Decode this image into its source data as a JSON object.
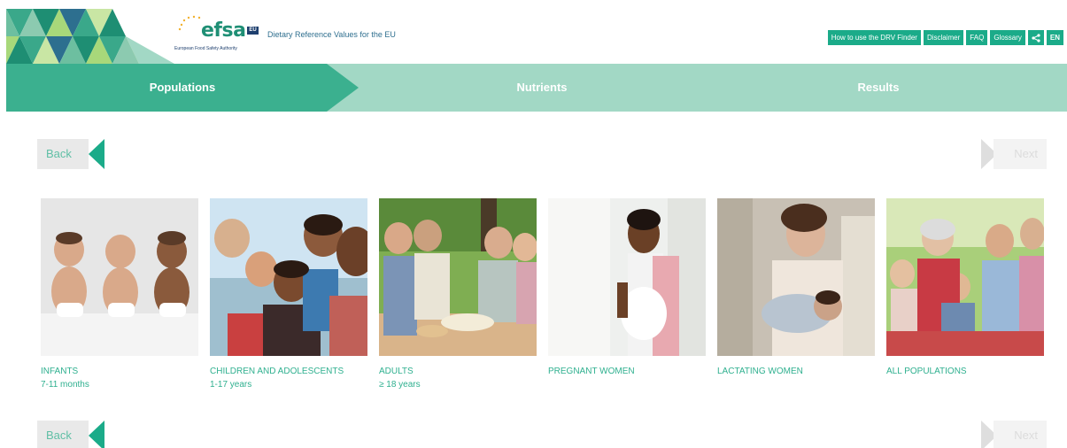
{
  "header": {
    "logo_word": "efsa",
    "logo_badge": "EU",
    "logo_subtitle": "European Food Safety Authority",
    "site_title": "Dietary Reference Values for the EU",
    "links": [
      {
        "label": "How to use the DRV Finder"
      },
      {
        "label": "Disclaimer"
      },
      {
        "label": "FAQ"
      },
      {
        "label": "Glossary"
      }
    ],
    "share_icon": "share-icon",
    "language": "EN"
  },
  "steps": [
    {
      "label": "Populations",
      "active": true
    },
    {
      "label": "Nutrients",
      "active": false
    },
    {
      "label": "Results",
      "active": false
    }
  ],
  "nav": {
    "back_label": "Back",
    "next_label": "Next",
    "back_enabled": true,
    "next_enabled": false
  },
  "populations": [
    {
      "title": "INFANTS",
      "subtitle": "7-11 months"
    },
    {
      "title": "CHILDREN AND ADOLESCENTS",
      "subtitle": "1-17 years"
    },
    {
      "title": "ADULTS",
      "subtitle": "≥ 18 years"
    },
    {
      "title": "PREGNANT WOMEN",
      "subtitle": ""
    },
    {
      "title": "LACTATING WOMEN",
      "subtitle": ""
    },
    {
      "title": "ALL POPULATIONS",
      "subtitle": ""
    }
  ],
  "colors": {
    "accent": "#1bab89",
    "step_active": "#3bb08f",
    "step_inactive": "#a2d8c5",
    "text_green": "#2fb08f"
  }
}
